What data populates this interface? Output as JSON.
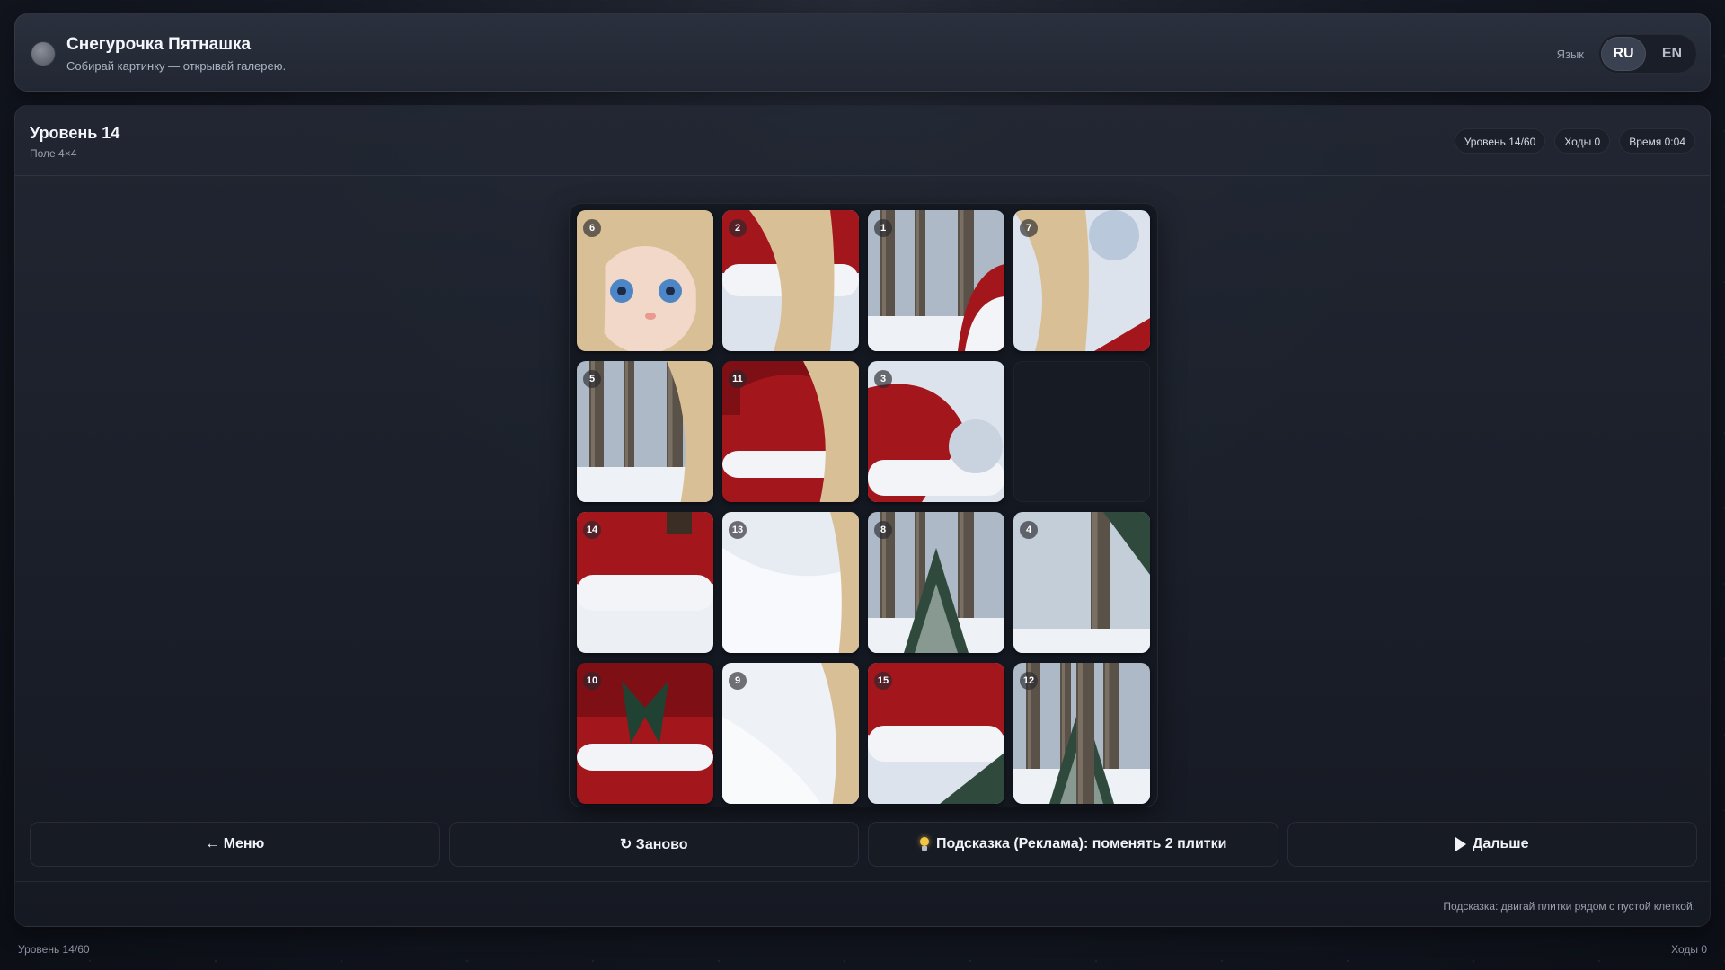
{
  "header": {
    "title": "Снегурочка Пятнашка",
    "subtitle": "Собирай картинку — открывай галерею.",
    "language_label": "Язык",
    "languages": [
      "RU",
      "EN"
    ],
    "active_language": "RU"
  },
  "level": {
    "title": "Уровень 14",
    "board_size": "Поле 4×4",
    "stats": {
      "level": "Уровень 14/60",
      "moves": "Ходы 0",
      "time": "Время 0:04"
    }
  },
  "board": {
    "rows": 4,
    "cols": 4,
    "tiles": [
      6,
      2,
      1,
      7,
      5,
      11,
      3,
      null,
      14,
      13,
      8,
      4,
      10,
      9,
      15,
      12
    ]
  },
  "actions": {
    "menu": "← Меню",
    "restart": "↻ Заново",
    "hint": "Подсказка (Реклама): поменять 2 плитки",
    "next": "Дальше"
  },
  "hint_text": "Подсказка: двигай плитки рядом с пустой клеткой.",
  "footer": {
    "level": "Уровень 14/60",
    "moves": "Ходы 0"
  },
  "colors": {
    "background": "#141822",
    "panel": "#222733",
    "accent_red": "#a3161c",
    "snow": "#f2f4f8",
    "hair": "#d9bf95",
    "bulb": "#f3c543"
  }
}
